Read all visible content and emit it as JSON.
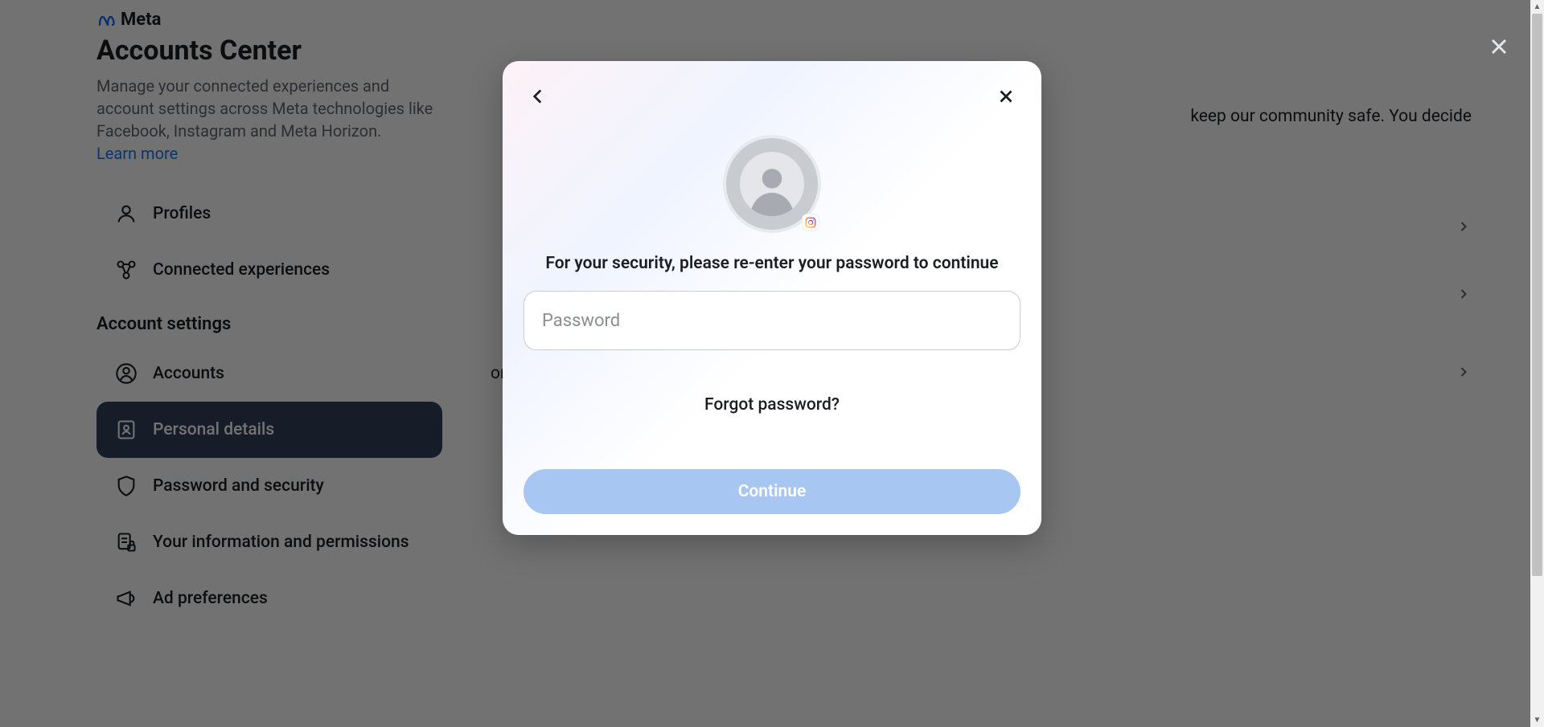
{
  "brand": {
    "name": "Meta"
  },
  "header": {
    "title": "Accounts Center",
    "subtitle": "Manage your connected experiences and account settings across Meta technologies like Facebook, Instagram and Meta Horizon.",
    "learn_more": "Learn more"
  },
  "sidebar": {
    "top_items": [
      {
        "icon": "user-icon",
        "label": "Profiles"
      },
      {
        "icon": "connections-icon",
        "label": "Connected experiences"
      }
    ],
    "section_label": "Account settings",
    "items": [
      {
        "icon": "account-icon",
        "label": "Accounts",
        "active": false
      },
      {
        "icon": "id-card-icon",
        "label": "Personal details",
        "active": true
      },
      {
        "icon": "shield-icon",
        "label": "Password and security",
        "active": false
      },
      {
        "icon": "doc-lock-icon",
        "label": "Your information and permissions",
        "active": false
      },
      {
        "icon": "megaphone-icon",
        "label": "Ad preferences",
        "active": false
      }
    ]
  },
  "main": {
    "partial_line_1": "keep our community safe. You decide",
    "partial_line_2": "or delete your accounts and"
  },
  "modal": {
    "message": "For your security, please re-enter your password to continue",
    "password_placeholder": "Password",
    "forgot": "Forgot password?",
    "continue": "Continue"
  }
}
